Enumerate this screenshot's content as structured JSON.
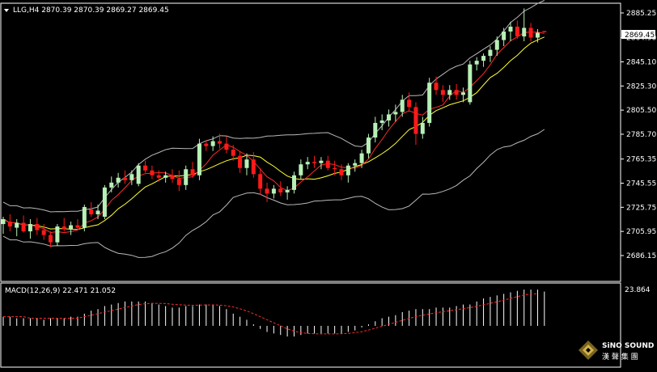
{
  "main_chart": {
    "symbol_line": "LLG,H4  2870.39 2870.39 2869.27 2869.45",
    "current_price_label": "2869.45",
    "price_ticks": [
      "2885.25",
      "2864.90",
      "2845.10",
      "2825.30",
      "2805.50",
      "2785.70",
      "2765.35",
      "2745.55",
      "2725.75",
      "2705.95",
      "2686.15"
    ]
  },
  "indicator_panel": {
    "label": "MACD(12,26,9) 22.471 21.052",
    "top_tick": "23.864"
  },
  "watermark": {
    "brand_text": "SiNO SOUND",
    "chinese_text": "漢 聲 集 團"
  },
  "colors": {
    "background": "#000000",
    "bull_candle": "#b7f0b7",
    "bear_candle": "#ff1a1a",
    "ma_fast": "#ff2a2a",
    "ma_slow": "#ffff33",
    "bollinger": "#b9b9b9",
    "macd_hist": "#ffffff",
    "macd_signal": "#ff2a2a",
    "grid_border": "#ffffff"
  },
  "chart_data": {
    "type": "candlestick",
    "y_range": [
      2686.15,
      2885.25
    ],
    "candles": [
      {
        "o": 2712,
        "h": 2718,
        "l": 2704,
        "c": 2716
      },
      {
        "o": 2714,
        "h": 2720,
        "l": 2706,
        "c": 2710
      },
      {
        "o": 2709,
        "h": 2716,
        "l": 2702,
        "c": 2713
      },
      {
        "o": 2713,
        "h": 2719,
        "l": 2705,
        "c": 2706
      },
      {
        "o": 2706,
        "h": 2716,
        "l": 2700,
        "c": 2712
      },
      {
        "o": 2712,
        "h": 2717,
        "l": 2703,
        "c": 2707
      },
      {
        "o": 2707,
        "h": 2712,
        "l": 2699,
        "c": 2703
      },
      {
        "o": 2703,
        "h": 2706,
        "l": 2693,
        "c": 2697
      },
      {
        "o": 2697,
        "h": 2712,
        "l": 2694,
        "c": 2710
      },
      {
        "o": 2710,
        "h": 2717,
        "l": 2706,
        "c": 2708
      },
      {
        "o": 2708,
        "h": 2714,
        "l": 2703,
        "c": 2711
      },
      {
        "o": 2711,
        "h": 2716,
        "l": 2707,
        "c": 2709
      },
      {
        "o": 2709,
        "h": 2728,
        "l": 2706,
        "c": 2726
      },
      {
        "o": 2724,
        "h": 2730,
        "l": 2718,
        "c": 2720
      },
      {
        "o": 2720,
        "h": 2728,
        "l": 2716,
        "c": 2723
      },
      {
        "o": 2718,
        "h": 2744,
        "l": 2716,
        "c": 2742
      },
      {
        "o": 2742,
        "h": 2751,
        "l": 2738,
        "c": 2746
      },
      {
        "o": 2746,
        "h": 2754,
        "l": 2742,
        "c": 2750
      },
      {
        "o": 2750,
        "h": 2756,
        "l": 2745,
        "c": 2748
      },
      {
        "o": 2748,
        "h": 2756,
        "l": 2744,
        "c": 2753
      },
      {
        "o": 2745,
        "h": 2762,
        "l": 2743,
        "c": 2760
      },
      {
        "o": 2760,
        "h": 2764,
        "l": 2754,
        "c": 2756
      },
      {
        "o": 2756,
        "h": 2760,
        "l": 2749,
        "c": 2752
      },
      {
        "o": 2752,
        "h": 2756,
        "l": 2747,
        "c": 2750
      },
      {
        "o": 2750,
        "h": 2755,
        "l": 2746,
        "c": 2752
      },
      {
        "o": 2752,
        "h": 2757,
        "l": 2746,
        "c": 2749
      },
      {
        "o": 2749,
        "h": 2756,
        "l": 2739,
        "c": 2744
      },
      {
        "o": 2744,
        "h": 2760,
        "l": 2740,
        "c": 2757
      },
      {
        "o": 2757,
        "h": 2763,
        "l": 2750,
        "c": 2752
      },
      {
        "o": 2752,
        "h": 2782,
        "l": 2748,
        "c": 2778
      },
      {
        "o": 2778,
        "h": 2781,
        "l": 2772,
        "c": 2776
      },
      {
        "o": 2776,
        "h": 2784,
        "l": 2772,
        "c": 2780
      },
      {
        "o": 2780,
        "h": 2786,
        "l": 2774,
        "c": 2778
      },
      {
        "o": 2778,
        "h": 2784,
        "l": 2770,
        "c": 2773
      },
      {
        "o": 2773,
        "h": 2777,
        "l": 2764,
        "c": 2768
      },
      {
        "o": 2768,
        "h": 2772,
        "l": 2754,
        "c": 2758
      },
      {
        "o": 2758,
        "h": 2770,
        "l": 2752,
        "c": 2765
      },
      {
        "o": 2765,
        "h": 2771,
        "l": 2750,
        "c": 2753
      },
      {
        "o": 2753,
        "h": 2758,
        "l": 2736,
        "c": 2741
      },
      {
        "o": 2741,
        "h": 2746,
        "l": 2730,
        "c": 2737
      },
      {
        "o": 2737,
        "h": 2744,
        "l": 2733,
        "c": 2741
      },
      {
        "o": 2741,
        "h": 2747,
        "l": 2735,
        "c": 2738
      },
      {
        "o": 2738,
        "h": 2743,
        "l": 2732,
        "c": 2740
      },
      {
        "o": 2740,
        "h": 2755,
        "l": 2737,
        "c": 2752
      },
      {
        "o": 2752,
        "h": 2765,
        "l": 2749,
        "c": 2761
      },
      {
        "o": 2761,
        "h": 2767,
        "l": 2757,
        "c": 2763
      },
      {
        "o": 2763,
        "h": 2768,
        "l": 2758,
        "c": 2762
      },
      {
        "o": 2762,
        "h": 2767,
        "l": 2757,
        "c": 2764
      },
      {
        "o": 2764,
        "h": 2768,
        "l": 2756,
        "c": 2758
      },
      {
        "o": 2758,
        "h": 2764,
        "l": 2752,
        "c": 2757
      },
      {
        "o": 2757,
        "h": 2761,
        "l": 2748,
        "c": 2752
      },
      {
        "o": 2752,
        "h": 2762,
        "l": 2746,
        "c": 2760
      },
      {
        "o": 2760,
        "h": 2765,
        "l": 2755,
        "c": 2762
      },
      {
        "o": 2762,
        "h": 2773,
        "l": 2758,
        "c": 2770
      },
      {
        "o": 2770,
        "h": 2786,
        "l": 2766,
        "c": 2783
      },
      {
        "o": 2783,
        "h": 2800,
        "l": 2779,
        "c": 2795
      },
      {
        "o": 2795,
        "h": 2802,
        "l": 2789,
        "c": 2797
      },
      {
        "o": 2797,
        "h": 2806,
        "l": 2792,
        "c": 2802
      },
      {
        "o": 2802,
        "h": 2810,
        "l": 2796,
        "c": 2804
      },
      {
        "o": 2804,
        "h": 2818,
        "l": 2800,
        "c": 2814
      },
      {
        "o": 2814,
        "h": 2820,
        "l": 2804,
        "c": 2808
      },
      {
        "o": 2808,
        "h": 2812,
        "l": 2777,
        "c": 2786
      },
      {
        "o": 2786,
        "h": 2800,
        "l": 2782,
        "c": 2795
      },
      {
        "o": 2795,
        "h": 2832,
        "l": 2792,
        "c": 2828
      },
      {
        "o": 2828,
        "h": 2833,
        "l": 2818,
        "c": 2822
      },
      {
        "o": 2822,
        "h": 2826,
        "l": 2812,
        "c": 2818
      },
      {
        "o": 2818,
        "h": 2826,
        "l": 2814,
        "c": 2822
      },
      {
        "o": 2822,
        "h": 2827,
        "l": 2814,
        "c": 2818
      },
      {
        "o": 2818,
        "h": 2824,
        "l": 2812,
        "c": 2820
      },
      {
        "o": 2812,
        "h": 2846,
        "l": 2810,
        "c": 2843
      },
      {
        "o": 2843,
        "h": 2849,
        "l": 2838,
        "c": 2846
      },
      {
        "o": 2846,
        "h": 2852,
        "l": 2841,
        "c": 2850
      },
      {
        "o": 2850,
        "h": 2858,
        "l": 2845,
        "c": 2855
      },
      {
        "o": 2855,
        "h": 2866,
        "l": 2850,
        "c": 2863
      },
      {
        "o": 2863,
        "h": 2873,
        "l": 2858,
        "c": 2870
      },
      {
        "o": 2870,
        "h": 2878,
        "l": 2862,
        "c": 2874
      },
      {
        "o": 2874,
        "h": 2879,
        "l": 2864,
        "c": 2866
      },
      {
        "o": 2866,
        "h": 2889,
        "l": 2862,
        "c": 2873
      },
      {
        "o": 2873,
        "h": 2877,
        "l": 2862,
        "c": 2865
      },
      {
        "o": 2865,
        "h": 2872,
        "l": 2861,
        "c": 2869
      },
      {
        "o": 2870.39,
        "h": 2870.39,
        "l": 2869.27,
        "c": 2869.45
      }
    ],
    "macd_range": [
      -25,
      23.864
    ],
    "macd_hist": [
      6,
      6,
      5,
      5,
      5,
      5,
      4,
      5,
      5,
      5,
      6,
      6,
      8,
      10,
      11,
      13,
      14,
      15,
      16,
      16,
      16,
      16,
      15,
      14,
      13,
      12,
      12,
      13,
      13,
      14,
      14,
      14,
      13,
      11,
      8,
      6,
      4,
      1,
      -2,
      -4,
      -5,
      -6,
      -7,
      -7,
      -6,
      -5,
      -5,
      -5,
      -5,
      -5,
      -5,
      -4,
      -3,
      -1,
      1,
      3,
      5,
      6,
      7,
      9,
      10,
      11,
      11,
      11,
      12,
      12,
      12,
      13,
      14,
      14,
      16,
      18,
      19,
      20,
      21,
      22,
      23,
      23.8,
      23.8,
      23.8,
      22.5
    ],
    "macd_signal": [
      6,
      6,
      6,
      6,
      5,
      5,
      5,
      5,
      5,
      5,
      5,
      5,
      6,
      7,
      8,
      9,
      10,
      11,
      12,
      13,
      14,
      14.5,
      14.8,
      14.8,
      14.6,
      14.2,
      13.8,
      13.6,
      13.5,
      13.6,
      13.7,
      13.7,
      13.6,
      13.2,
      12.4,
      11.2,
      9.8,
      8,
      6,
      4,
      2,
      0,
      -2,
      -3.5,
      -4.5,
      -5,
      -5.2,
      -5.3,
      -5.3,
      -5.3,
      -5.2,
      -5,
      -4.5,
      -3.8,
      -2.8,
      -1.6,
      -0.3,
      1,
      2.3,
      3.6,
      4.9,
      6,
      7,
      7.8,
      8.6,
      9.3,
      9.9,
      10.6,
      11.3,
      12,
      12.8,
      13.8,
      14.8,
      15.8,
      16.9,
      18,
      19.2,
      20.3,
      21,
      21.05
    ]
  }
}
